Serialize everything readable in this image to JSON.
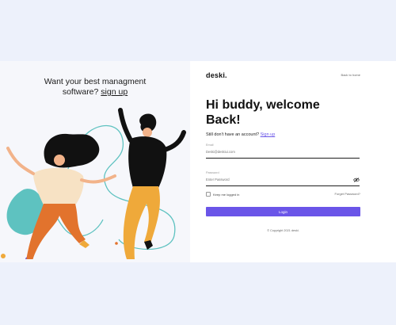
{
  "hero": {
    "line1": "Want your best managment",
    "line2_prefix": "software? ",
    "line2_link": "sign up"
  },
  "brand": {
    "logo": "deski."
  },
  "nav": {
    "back_link": "Back to home"
  },
  "welcome": {
    "line1": "Hi buddy, welcome",
    "line2": "Back!"
  },
  "signup": {
    "prompt": "Still don't have an account? ",
    "link": "Sign up"
  },
  "form": {
    "email_label": "Email",
    "email_placeholder": "Deski@deskiui.com",
    "password_label": "Password",
    "password_placeholder": "Enter Password",
    "remember_label": "Keep me logged in",
    "forgot_link": "Forget Password?",
    "login_button": "Login"
  },
  "footer": {
    "copyright": "© Copyright 2021 deski."
  },
  "colors": {
    "accent": "#6a55e8",
    "page_bg": "#edf1fb",
    "left_panel_bg": "#f6f7fb",
    "teal_blob": "#5ec2c0",
    "pants_orange": "#e2732d",
    "pants_yellow": "#efa93a",
    "hair": "#111111"
  }
}
